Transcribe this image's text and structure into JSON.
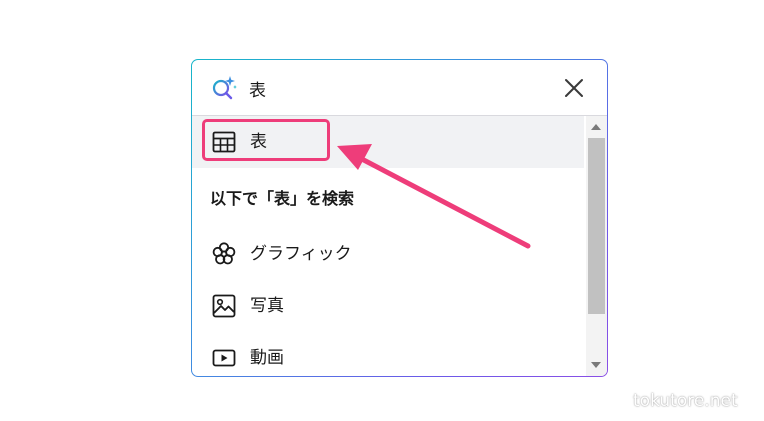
{
  "search": {
    "value": "表",
    "icon": "magic-search-icon",
    "close_icon": "close-icon"
  },
  "results": {
    "top_item": {
      "label": "表",
      "icon": "table-icon"
    },
    "section_title": "以下で「表」を検索",
    "items": [
      {
        "label": "グラフィック",
        "icon": "flower-icon"
      },
      {
        "label": "写真",
        "icon": "photo-icon"
      },
      {
        "label": "動画",
        "icon": "video-icon"
      }
    ]
  },
  "colors": {
    "annotation": "#ee3d7a",
    "border_gradient_start": "#17b6c9",
    "border_gradient_end": "#8a4fe6",
    "highlight_bg": "#f1f2f4"
  },
  "watermark": "tokutore.net"
}
